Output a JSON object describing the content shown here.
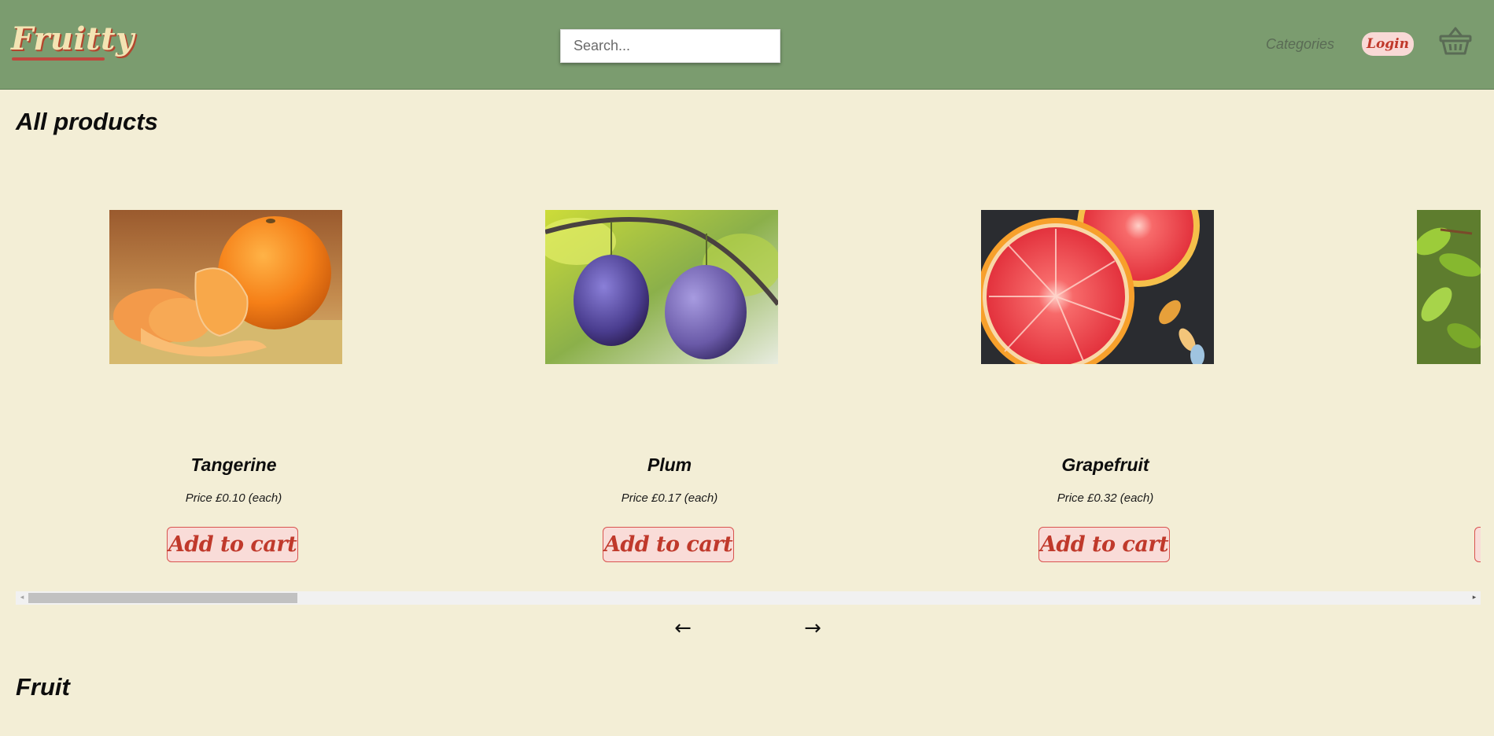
{
  "header": {
    "logo_text": "Fruitty",
    "search_placeholder": "Search...",
    "categories_label": "Categories",
    "login_label": "Login",
    "basket_icon": "basket-icon"
  },
  "sections": [
    {
      "title": "All products"
    },
    {
      "title": "Fruit"
    }
  ],
  "products": [
    {
      "name": "Tangerine",
      "price": "Price £0.10 (each)",
      "add_label": "Add to cart",
      "image": "tangerine"
    },
    {
      "name": "Plum",
      "price": "Price £0.17 (each)",
      "add_label": "Add to cart",
      "image": "plum"
    },
    {
      "name": "Grapefruit",
      "price": "Price £0.32 (each)",
      "add_label": "Add to cart",
      "image": "grapefruit"
    },
    {
      "name": "",
      "price": "",
      "add_label": "",
      "image": "leaves-partial"
    }
  ],
  "carousel": {
    "prev_label": "←",
    "next_label": "→",
    "scroll_left_glyph": "◂",
    "scroll_right_glyph": "▸"
  },
  "colors": {
    "header_bg": "#7b9c6f",
    "page_bg": "#f3eed6",
    "button_bg": "#f9dcd8",
    "button_text": "#c0392b",
    "logo_color": "#f3e4b3"
  }
}
